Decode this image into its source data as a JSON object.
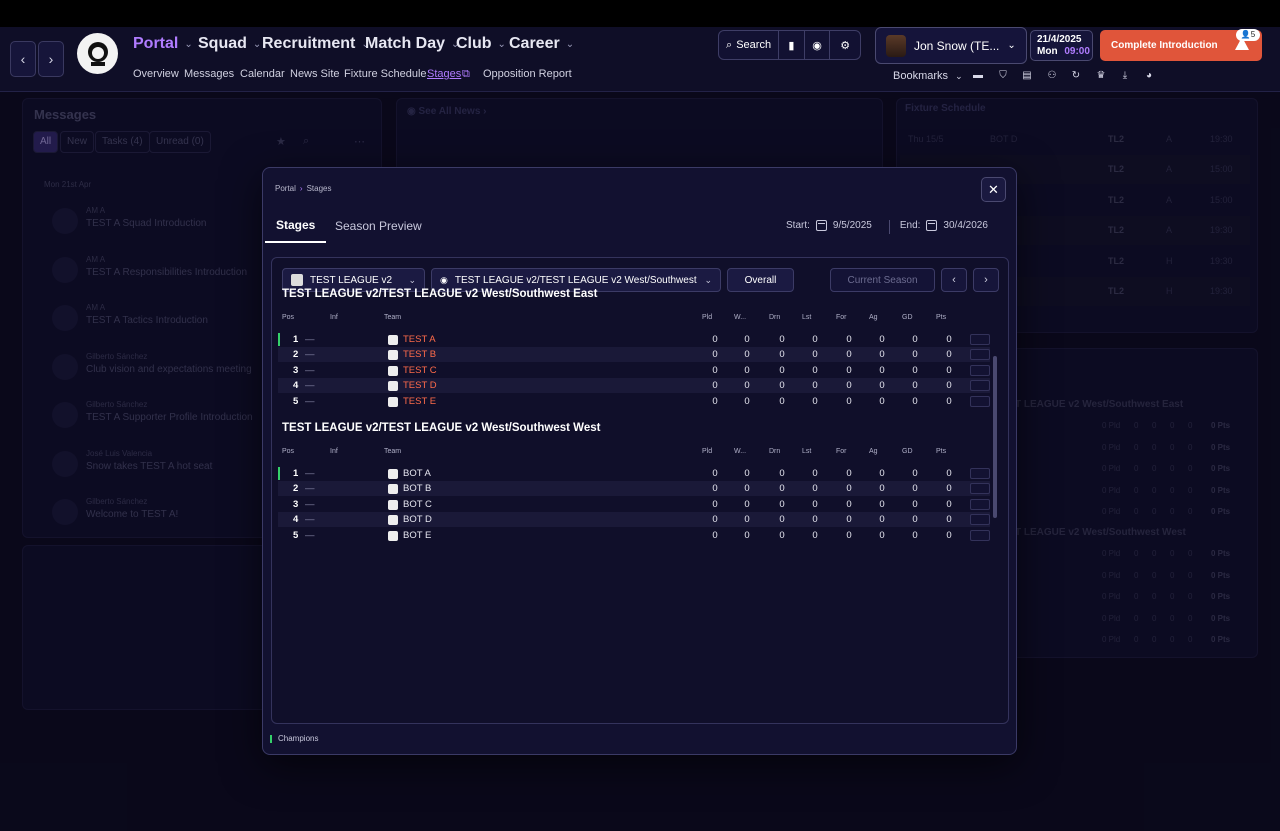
{
  "header": {
    "nav": [
      {
        "label": "Portal",
        "active": true
      },
      {
        "label": "Squad"
      },
      {
        "label": "Recruitment"
      },
      {
        "label": "Match Day"
      },
      {
        "label": "Club"
      },
      {
        "label": "Career"
      }
    ],
    "subnav": [
      "Overview",
      "Messages",
      "Calendar",
      "News Site",
      "Fixture Schedule",
      "Stages",
      "Opposition Report"
    ],
    "search_label": "Search",
    "profile_name": "Jon Snow (TE...",
    "date": "21/4/2025",
    "day": "Mon",
    "time": "09:00",
    "complete_label": "Complete Introduction",
    "notif_count": "5",
    "bookmarks_label": "Bookmarks"
  },
  "messages": {
    "title": "Messages",
    "filters": [
      "All",
      "New",
      "Tasks (4)",
      "Unread (0)"
    ],
    "date": "Mon 21st Apr",
    "items": [
      {
        "from": "AM A",
        "subject": "TEST A Squad Introduction"
      },
      {
        "from": "AM A",
        "subject": "TEST A Responsibilities Introduction"
      },
      {
        "from": "AM A",
        "subject": "TEST A Tactics Introduction"
      },
      {
        "from": "Gilberto Sánchez",
        "subject": "Club vision and expectations meeting"
      },
      {
        "from": "Gilberto Sánchez",
        "subject": "TEST A Supporter Profile Introduction"
      },
      {
        "from": "José Luis Valencia",
        "subject": "Snow takes TEST A hot seat"
      },
      {
        "from": "Gilberto Sánchez",
        "subject": "Welcome to TEST A!"
      }
    ]
  },
  "news": {
    "title": "See All News"
  },
  "fixtures": {
    "title": "Fixture Schedule",
    "rows": [
      {
        "date": "Thu 15/5",
        "team": "BOT D",
        "comp": "TL2",
        "venue": "A",
        "time": "19:30"
      },
      {
        "date": "",
        "team": "",
        "comp": "TL2",
        "venue": "A",
        "time": "15:00"
      },
      {
        "date": "",
        "team": "",
        "comp": "TL2",
        "venue": "A",
        "time": "15:00"
      },
      {
        "date": "",
        "team": "",
        "comp": "TL2",
        "venue": "A",
        "time": "19:30"
      },
      {
        "date": "",
        "team": "",
        "comp": "TL2",
        "venue": "H",
        "time": "19:30"
      },
      {
        "date": "",
        "team": "",
        "comp": "TL2",
        "venue": "H",
        "time": "19:30"
      }
    ]
  },
  "right_table": {
    "group1": "T LEAGUE v2 West/Southwest East",
    "group2": "T LEAGUE v2 West/Southwest West",
    "pld": "0 Pld",
    "zero": "0",
    "pts": "0 Pts"
  },
  "modal": {
    "breadcrumb": [
      "Portal",
      "Stages"
    ],
    "tabs": [
      "Stages",
      "Season Preview"
    ],
    "start_label": "Start:",
    "start_date": "9/5/2025",
    "end_label": "End:",
    "end_date": "30/4/2026",
    "league_select": "TEST LEAGUE v2",
    "stage_select": "TEST LEAGUE v2/TEST LEAGUE v2 West/Southwest",
    "overall_label": "Overall",
    "season_label": "Current Season",
    "columns": [
      "Pos",
      "Inf",
      "Team",
      "Pld",
      "W...",
      "Drn",
      "Lst",
      "For",
      "Ag",
      "GD",
      "Pts"
    ],
    "groups": [
      {
        "title": "TEST LEAGUE v2/TEST LEAGUE v2 West/Southwest East",
        "rows": [
          {
            "pos": "1",
            "team": "TEST A",
            "stats": [
              "0",
              "0",
              "0",
              "0",
              "0",
              "0",
              "0",
              "0"
            ],
            "champion": true
          },
          {
            "pos": "2",
            "team": "TEST B",
            "stats": [
              "0",
              "0",
              "0",
              "0",
              "0",
              "0",
              "0",
              "0"
            ]
          },
          {
            "pos": "3",
            "team": "TEST C",
            "stats": [
              "0",
              "0",
              "0",
              "0",
              "0",
              "0",
              "0",
              "0"
            ]
          },
          {
            "pos": "4",
            "team": "TEST D",
            "stats": [
              "0",
              "0",
              "0",
              "0",
              "0",
              "0",
              "0",
              "0"
            ]
          },
          {
            "pos": "5",
            "team": "TEST E",
            "stats": [
              "0",
              "0",
              "0",
              "0",
              "0",
              "0",
              "0",
              "0"
            ]
          }
        ]
      },
      {
        "title": "TEST LEAGUE v2/TEST LEAGUE v2 West/Southwest West",
        "rows": [
          {
            "pos": "1",
            "team": "BOT A",
            "stats": [
              "0",
              "0",
              "0",
              "0",
              "0",
              "0",
              "0",
              "0"
            ],
            "champion": true
          },
          {
            "pos": "2",
            "team": "BOT B",
            "stats": [
              "0",
              "0",
              "0",
              "0",
              "0",
              "0",
              "0",
              "0"
            ]
          },
          {
            "pos": "3",
            "team": "BOT C",
            "stats": [
              "0",
              "0",
              "0",
              "0",
              "0",
              "0",
              "0",
              "0"
            ]
          },
          {
            "pos": "4",
            "team": "BOT D",
            "stats": [
              "0",
              "0",
              "0",
              "0",
              "0",
              "0",
              "0",
              "0"
            ]
          },
          {
            "pos": "5",
            "team": "BOT E",
            "stats": [
              "0",
              "0",
              "0",
              "0",
              "0",
              "0",
              "0",
              "0"
            ]
          }
        ]
      }
    ],
    "legend": "Champions",
    "dash": "—"
  },
  "colors": {
    "accent": "#b07cff",
    "highlight": "#ff6b4a",
    "champion": "#35d06a",
    "cta": "#e0553a"
  }
}
